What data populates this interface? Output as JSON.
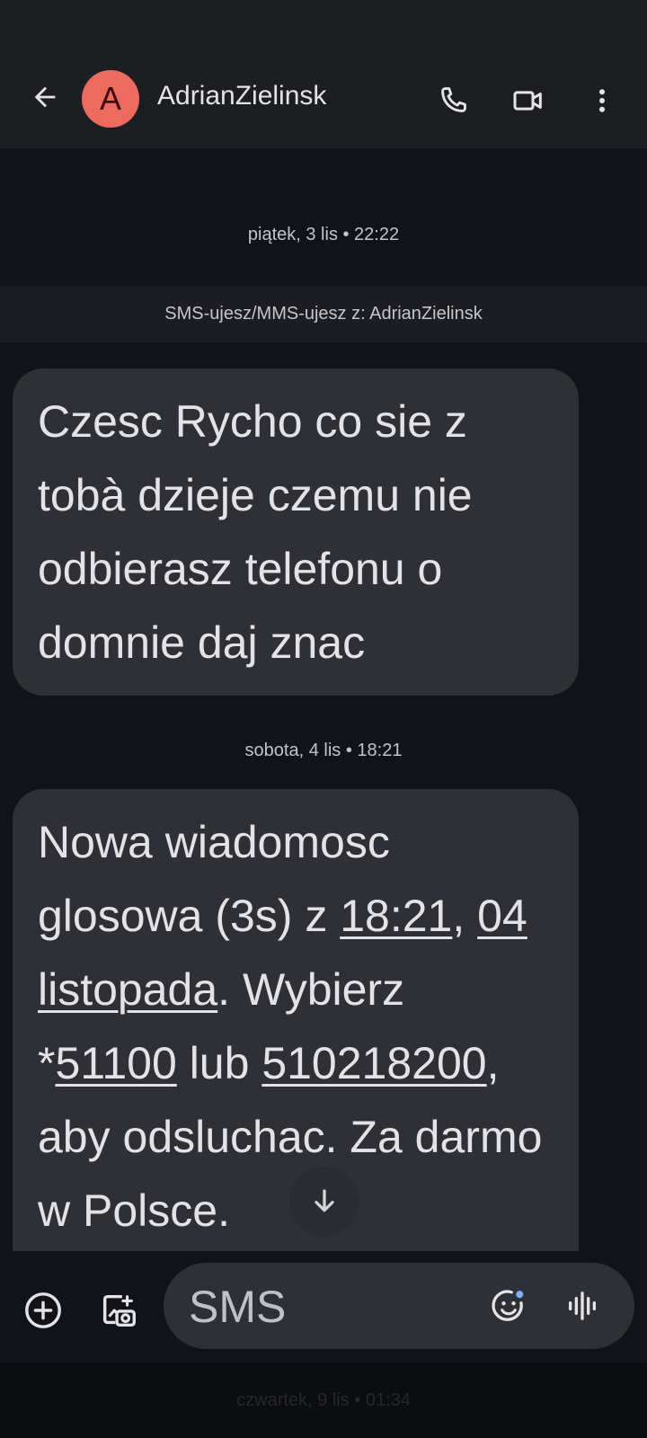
{
  "header": {
    "avatar_letter": "A",
    "contact_name": "AdrianZielinsk",
    "icons": {
      "back": "arrow-back-icon",
      "call": "phone-icon",
      "video": "video-camera-icon",
      "more": "more-vert-icon"
    }
  },
  "conversation": {
    "date_1": "piątek, 3 lis • 22:22",
    "info_strip": "SMS-ujesz/MMS-ujesz z: AdrianZielinsk",
    "message_1": "Czesc Rycho co sie z tobà dzieje czemu nie odbierasz telefonu o domnie daj znac",
    "date_2": "sobota, 4 lis • 18:21",
    "message_2": {
      "part_1": "Nowa wiadomosc glosowa (3s) z ",
      "link_time": "18:21",
      "sep_1": ", ",
      "link_date": "04 listopada",
      "part_2": ". Wybierz *",
      "link_code": "51100",
      "part_3": " lub ",
      "link_number": "510218200",
      "part_4": ", aby odsluchac. Za darmo w Polsce."
    },
    "hidden_date": "czwartek, 9 lis • 01:34"
  },
  "compose": {
    "placeholder": "SMS",
    "icons": {
      "add": "add-circle-icon",
      "gallery": "gallery-icon",
      "emoji": "emoji-icon",
      "voice": "voice-waveform-icon"
    }
  },
  "colors": {
    "background": "#111318",
    "header": "#1c1e22",
    "bubble": "#2e3035",
    "avatar": "#ec6a5e"
  }
}
